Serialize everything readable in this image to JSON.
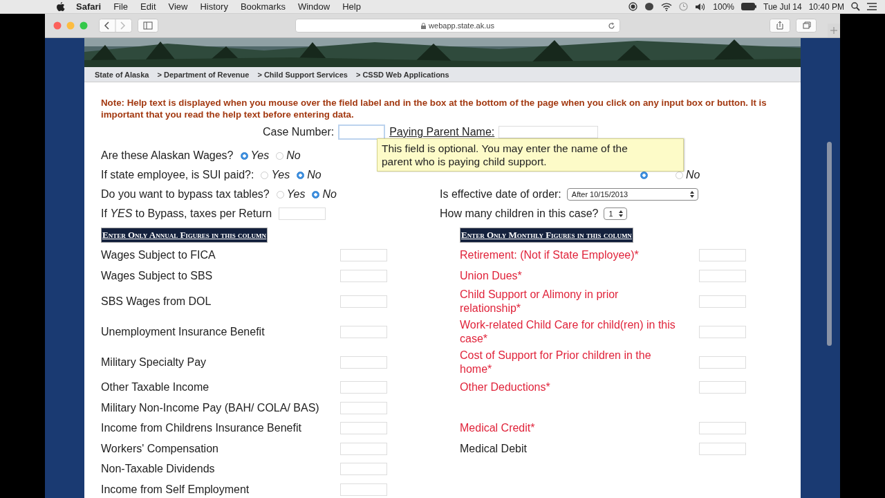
{
  "menu_bar": {
    "app": "Safari",
    "items": [
      "File",
      "Edit",
      "View",
      "History",
      "Bookmarks",
      "Window",
      "Help"
    ],
    "battery": "100%",
    "date": "Tue Jul 14",
    "time": "10:40 PM"
  },
  "browser": {
    "address": "webapp.state.ak.us"
  },
  "breadcrumb": [
    "State of Alaska",
    "> Department of Revenue",
    "> Child Support Services",
    "> CSSD Web Applications"
  ],
  "note": "Note: Help text is displayed when you mouse over the field label and in the box at the bottom of the page when you click on any input box or button. It is important that you read the help text before entering data.",
  "case_number": {
    "label": "Case Number:"
  },
  "paying_parent_name": {
    "label": "Paying Parent Name:"
  },
  "tooltip": "This field is optional. You may enter the name of the parent who is paying child support.",
  "left_questions": [
    {
      "kind": "radio",
      "label": "Are these Alaskan Wages?",
      "options": [
        {
          "label": "Yes",
          "selected": true
        },
        {
          "label": "No",
          "selected": false
        }
      ]
    },
    {
      "kind": "radio",
      "label": "If state employee, is SUI paid?:",
      "options": [
        {
          "label": "Yes",
          "selected": false
        },
        {
          "label": "No",
          "selected": true
        }
      ]
    },
    {
      "kind": "radio",
      "label": "Do you want to bypass tax tables?",
      "options": [
        {
          "label": "Yes",
          "selected": false
        },
        {
          "label": "No",
          "selected": true
        }
      ]
    },
    {
      "kind": "field",
      "label": "If **YES** to Bypass, taxes per Return"
    }
  ],
  "right_questions": [
    {
      "kind": "radio",
      "options": [
        {
          "selected": true
        },
        {
          "label": "No",
          "selected": false
        }
      ]
    },
    {
      "kind": "select",
      "label": "Is effective date of order:",
      "value": "After 10/15/2013"
    },
    {
      "kind": "select",
      "label": "How many children in this case?",
      "value": "1"
    }
  ],
  "figures": {
    "headers": [
      "Enter Only Annual Figures in this column",
      "Enter Only Monthly Figures in this column"
    ],
    "rows": [
      {
        "left": "Wages Subject to FICA",
        "right": {
          "label": "Retirement: (Not if State Employee)*",
          "required": true
        }
      },
      {
        "left": "Wages Subject to SBS",
        "right": {
          "label": "Union Dues*",
          "required": true
        }
      },
      {
        "left": "SBS Wages from DOL",
        "right": {
          "label": "Child Support or Alimony in prior relationship*",
          "required": true
        }
      },
      {
        "left": "Unemployment Insurance Benefit",
        "right": {
          "label": "Work-related Child Care for child(ren) in this case*",
          "required": true
        }
      },
      {
        "left": "Military Specialty Pay",
        "right": {
          "label": "Cost of Support for Prior children in the home*",
          "required": true
        }
      },
      {
        "left": "Other Taxable Income",
        "right": {
          "label": "Other Deductions*",
          "required": true
        }
      },
      {
        "left": "Military Non-Income Pay (BAH/ COLA/ BAS)"
      },
      {
        "left": "Income from Childrens Insurance Benefit",
        "right": {
          "label": "Medical Credit*",
          "required": true
        }
      },
      {
        "left": "Workers' Compensation",
        "right": {
          "label": "Medical Debit",
          "required": false
        }
      },
      {
        "left": "Non-Taxable Dividends"
      },
      {
        "left": "Income from Self Employment"
      }
    ]
  }
}
